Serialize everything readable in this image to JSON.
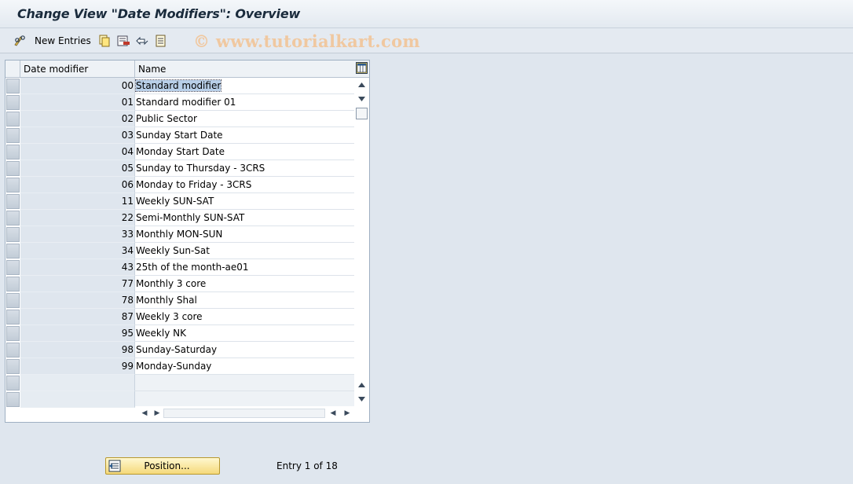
{
  "window": {
    "title": "Change View \"Date Modifiers\": Overview"
  },
  "toolbar": {
    "new_entries_label": "New Entries",
    "watermark": "© www.tutorialkart.com",
    "icons": [
      "edit-glasses-icon",
      "copy-icon",
      "delete-icon",
      "undo-change-icon",
      "select-block-icon"
    ]
  },
  "table": {
    "columns": [
      "Date modifier",
      "Name"
    ],
    "rows": [
      {
        "key": "00",
        "name": "Standard modifier",
        "selected": true
      },
      {
        "key": "01",
        "name": "Standard modifier 01"
      },
      {
        "key": "02",
        "name": "Public Sector"
      },
      {
        "key": "03",
        "name": "Sunday Start Date"
      },
      {
        "key": "04",
        "name": "Monday Start Date"
      },
      {
        "key": "05",
        "name": "Sunday to Thursday - 3CRS"
      },
      {
        "key": "06",
        "name": "Monday to Friday - 3CRS"
      },
      {
        "key": "11",
        "name": "Weekly SUN-SAT"
      },
      {
        "key": "22",
        "name": "Semi-Monthly SUN-SAT"
      },
      {
        "key": "33",
        "name": "Monthly MON-SUN"
      },
      {
        "key": "34",
        "name": "Weekly Sun-Sat"
      },
      {
        "key": "43",
        "name": "25th of the month-ae01"
      },
      {
        "key": "77",
        "name": "Monthly 3 core"
      },
      {
        "key": "78",
        "name": "Monthly Shal"
      },
      {
        "key": "87",
        "name": "Weekly 3 core"
      },
      {
        "key": "95",
        "name": "Weekly NK"
      },
      {
        "key": "98",
        "name": "Sunday-Saturday"
      },
      {
        "key": "99",
        "name": "Monday-Sunday"
      },
      {
        "key": "",
        "name": ""
      },
      {
        "key": "",
        "name": ""
      }
    ]
  },
  "footer": {
    "position_button_label": "Position...",
    "entry_info": "Entry 1 of 18"
  },
  "colors": {
    "accent": "#f5d97a",
    "background": "#dfe6ee",
    "selection": "#b8cfe8"
  }
}
